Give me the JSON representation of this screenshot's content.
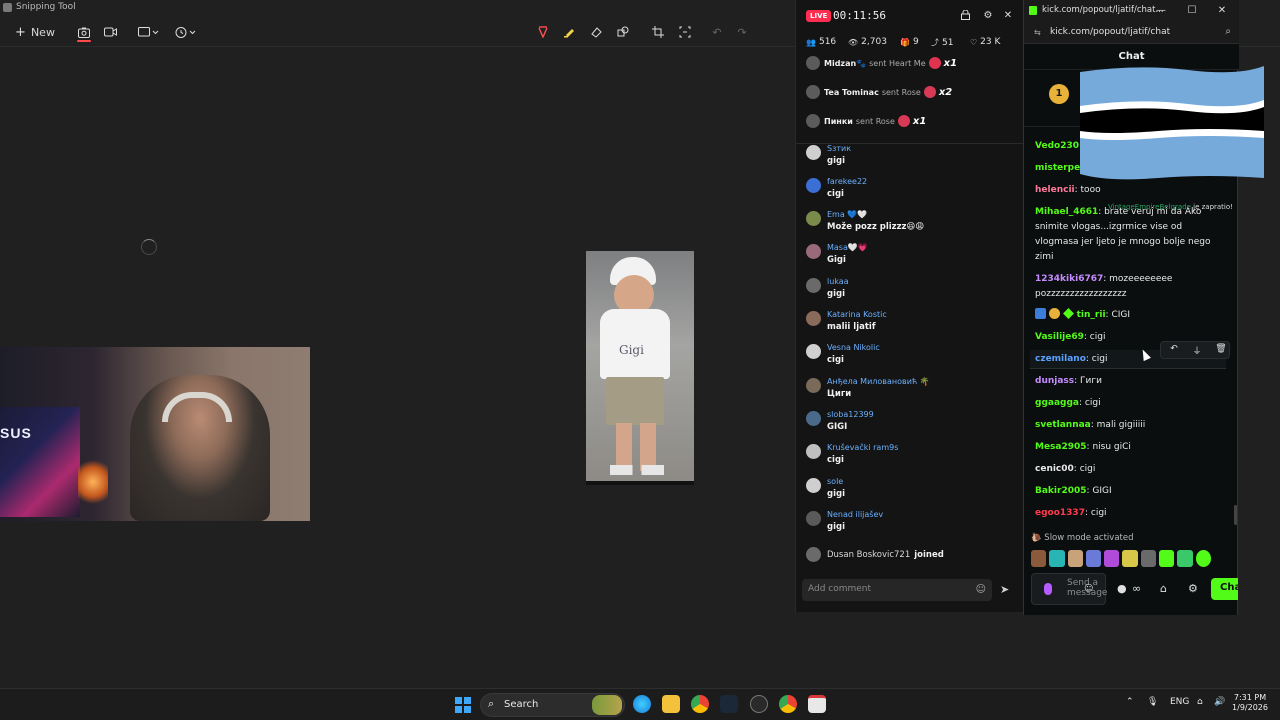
{
  "snipping_tool": {
    "title": "Snipping Tool",
    "new_label": "New"
  },
  "photo": {
    "shirt_text": "Gigi"
  },
  "live_panel": {
    "badge": "LIVE",
    "time": "00:11:56",
    "stats": {
      "viewers": "516",
      "views": "2,703",
      "gifts": "9",
      "shares": "51",
      "likes": "23 K"
    },
    "gifts": [
      {
        "user": "Midzan🐾",
        "action": "sent Heart Me",
        "mult": "x1",
        "color": "#e0334f"
      },
      {
        "user": "Tea Tominac",
        "action": "sent Rose",
        "mult": "x2",
        "color": "#d83a55"
      },
      {
        "user": "Пинки",
        "action": "sent Rose",
        "mult": "x1",
        "color": "#d83a55"
      }
    ],
    "comments": [
      {
        "name": "Sзтик",
        "text": "gigi"
      },
      {
        "name": "farekee22",
        "text": "cigi"
      },
      {
        "name": "Ema 💙🤍",
        "text": "Može pozz plizzz😆😩"
      },
      {
        "name": "Masa🤍💗",
        "text": "Gigi"
      },
      {
        "name": "lukaa",
        "text": "gigi"
      },
      {
        "name": "Katarina Kostic",
        "text": "malii ljatif"
      },
      {
        "name": "Vesna Nikolic",
        "text": "cigi"
      },
      {
        "name": "Анђела Миловановић 🌴",
        "text": "Циги"
      },
      {
        "name": "sloba12399",
        "text": "GIGI"
      },
      {
        "name": "Kruševački ram9s",
        "text": "cigi"
      },
      {
        "name": "sole",
        "text": "gigi"
      },
      {
        "name": "Nenad ilijašev",
        "text": "gigi"
      }
    ],
    "joined": {
      "name": "Dusan Boskovic721",
      "action": "joined"
    },
    "add_comment_placeholder": "Add comment"
  },
  "kick": {
    "window_title": "kick.com/popout/ljatif/chat...",
    "url": "kick.com/popout/ljatif/chat",
    "chat_header": "Chat",
    "pinned_badge": "1",
    "system_line": {
      "user": "VintageEmpireBelgrade",
      "rest": "je zapratio!"
    },
    "messages": [
      {
        "user": "Vedo230",
        "text": "",
        "color": "#53fc18"
      },
      {
        "user": "misterpe",
        "text": "",
        "color": "#53fc18"
      },
      {
        "user": "helencii",
        "text": "tooo",
        "color": "#ff7a9a"
      },
      {
        "user": "Mihael_4661",
        "text": "brate veruj mi da Ako snimite vlogas...izgrmice vise od vlogmasa jer ljeto je mnogo bolje nego zimi",
        "color": "#53fc18"
      },
      {
        "user": "1234kiki6767",
        "text": "mozeeeeeeee pozzzzzzzzzzzzzzzzz",
        "color": "#c58cff"
      },
      {
        "user": "tin_rii",
        "text": "CIGI",
        "color": "#53fc18"
      },
      {
        "user": "Vasilije69",
        "text": "cigi",
        "color": "#53fc18"
      },
      {
        "user": "czemilano",
        "text": "cigi",
        "color": "#5aa0ff"
      },
      {
        "user": "dunjass",
        "text": "Гиги",
        "color": "#c58cff"
      },
      {
        "user": "ggaagga",
        "text": "cigi",
        "color": "#53fc18"
      },
      {
        "user": "svetlannaa",
        "text": "mali gigiiiii",
        "color": "#53fc18"
      },
      {
        "user": "Mesa2905",
        "text": "nisu giCi",
        "color": "#53fc18"
      },
      {
        "user": "cenic00",
        "text": "cigi",
        "color": "#e8e8e8"
      },
      {
        "user": "Bakir2005",
        "text": "GIGI",
        "color": "#53fc18"
      },
      {
        "user": "egoo1337",
        "text": "cigi",
        "color": "#ff3b4d"
      }
    ],
    "slow_mode": "Slow mode activated",
    "send_placeholder": "Send a message",
    "chat_button": "Chat"
  },
  "taskbar": {
    "search_label": "Search",
    "lang": "ENG",
    "time": "7:31 PM",
    "date": "1/9/2026"
  },
  "colors": {
    "kick_green": "#53fc18",
    "live_red": "#ff2d4f",
    "botswana_blue": "#75aadb"
  }
}
